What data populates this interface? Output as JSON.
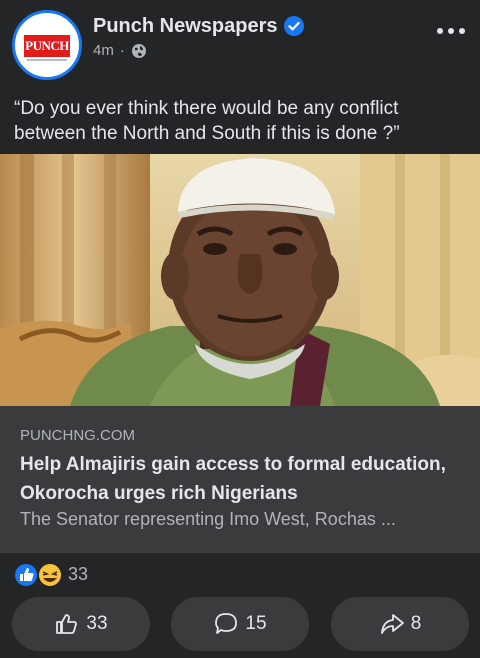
{
  "post": {
    "page_name": "Punch Newspapers",
    "avatar_text": "PUNCH",
    "time": "4m",
    "separator": "·",
    "caption": "“Do you ever think there would be any conflict between the North and South if this is done ?”"
  },
  "link_preview": {
    "domain": "PUNCHNG.COM",
    "title": "Help Almajiris gain access to formal education, Okorocha urges rich Nigerians",
    "description": "The Senator representing Imo West, Rochas ..."
  },
  "engagement": {
    "reaction_count": "33",
    "like_count": "33",
    "comment_count": "15",
    "share_count": "8"
  },
  "colors": {
    "background": "#18191a",
    "card": "#242526",
    "link_box": "#3a3b3c",
    "accent": "#1877f2",
    "brand_red": "#e21b1b"
  },
  "icons": [
    "verified-badge-icon",
    "globe-icon",
    "more-options-icon",
    "like-reaction-icon",
    "haha-reaction-icon",
    "thumbs-up-icon",
    "comment-icon",
    "share-icon"
  ]
}
